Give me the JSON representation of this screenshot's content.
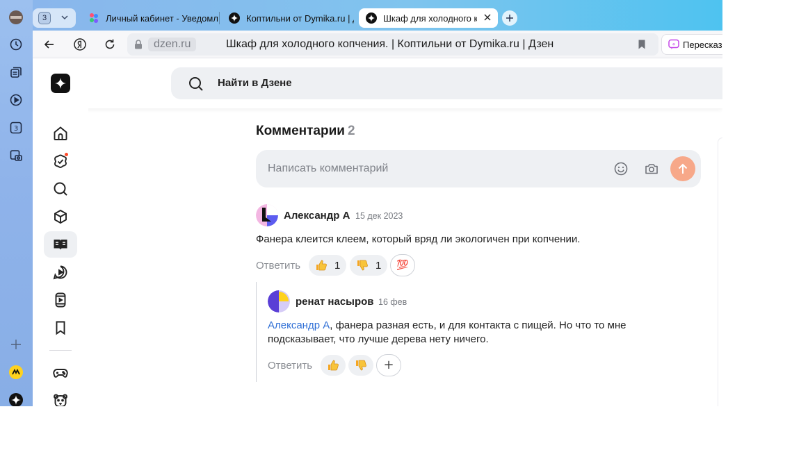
{
  "tabs": {
    "counter": "3",
    "items": [
      {
        "label": "Личный кабинет - Уведомл",
        "icon": "dzen-studio-icon"
      },
      {
        "label": "Коптильни от Dymika.ru | Д",
        "icon": "dzen-logo-icon"
      },
      {
        "label": "Шкаф для холодного копче",
        "icon": "dzen-logo-icon",
        "active": true
      }
    ]
  },
  "toolbar": {
    "domain": "dzen.ru",
    "page_title": "Шкаф для холодного копчения. | Коптильни от Dymika.ru | Дзен",
    "retell_label": "Пересказ"
  },
  "rail": {
    "counter_badge": "3"
  },
  "header": {
    "search_placeholder": "Найти в Дзене"
  },
  "comments": {
    "title": "Комментарии",
    "count": "2",
    "input_placeholder": "Написать комментарий",
    "items": [
      {
        "author": "Александр А",
        "date": "15 дек 2023",
        "text": "Фанера клеится клеем, который вряд ли экологичен при копчении.",
        "reply_label": "Ответить",
        "likes": "1",
        "dislikes": "1",
        "extra_reaction": "💯"
      },
      {
        "author": "ренат насыров",
        "date": "16 фев",
        "mention": "Александр А",
        "text_line1": ", фанера разная есть, и для контакта с пищей. Но что то мне",
        "text_line2": "подсказывает, что лучше дерева нету ничего.",
        "reply_label": "Ответить",
        "add_reaction": "+"
      }
    ]
  },
  "colors": {
    "accent_orange": "#f7a889",
    "mention_blue": "#2f6fd6",
    "badge_red": "#ff4b2b"
  }
}
